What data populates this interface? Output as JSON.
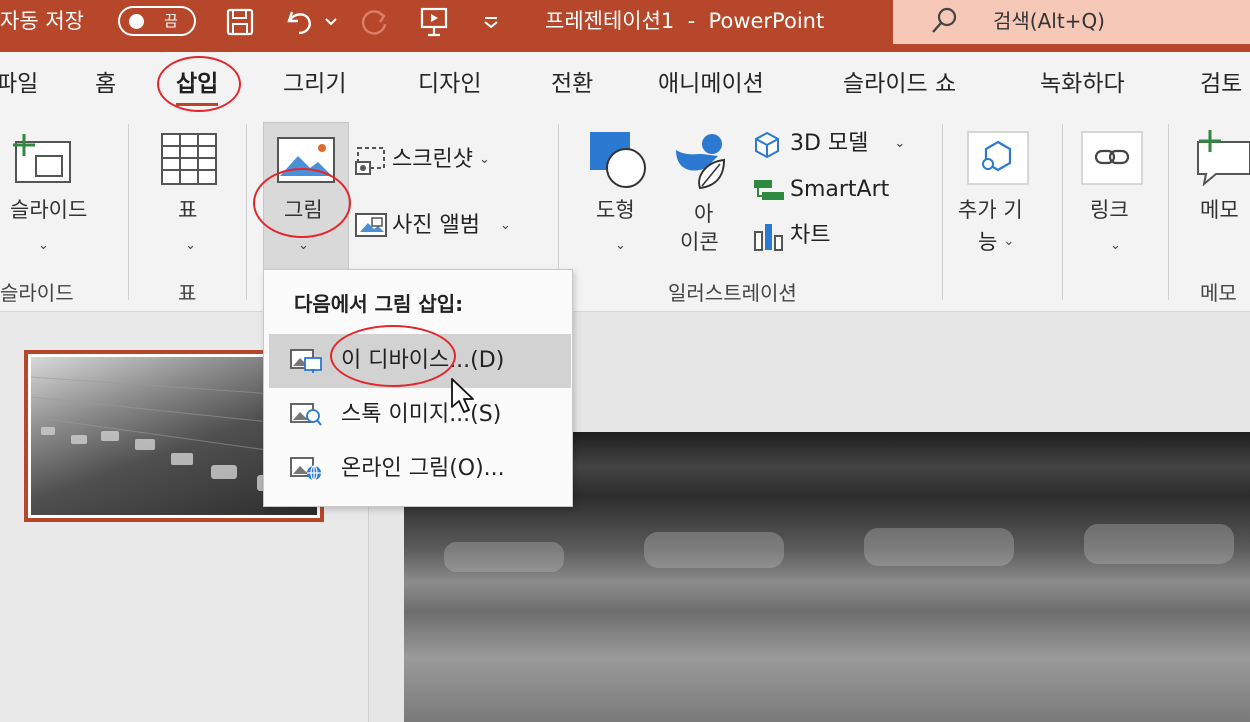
{
  "titlebar": {
    "autosave_label": "자동 저장",
    "autosave_state": "끔",
    "title": "프레젠테이션1  -  PowerPoint",
    "search_placeholder": "검색(Alt+Q)",
    "bg_color": "#b7472a"
  },
  "tabs": [
    "파일",
    "홈",
    "삽입",
    "그리기",
    "디자인",
    "전환",
    "애니메이션",
    "슬라이드 쇼",
    "녹화하다",
    "검토"
  ],
  "active_tab": "삽입",
  "ribbon": {
    "slide_button": "슬라이드",
    "slide_group": "슬라이드",
    "table_button": "표",
    "table_group": "표",
    "picture_button": "그림",
    "screenshot_button": "스크린샷",
    "photo_album_button": "사진 앨범",
    "shapes_button": "도형",
    "icons_button_line1": "아",
    "icons_button_line2": "이콘",
    "model3d_button": "3D 모델",
    "smartart_button": "SmartArt",
    "chart_button": "차트",
    "illustrations_group": "일러스트레이션",
    "addins_button_line1": "추가 기",
    "addins_button_line2": "능",
    "link_button": "링크",
    "comment_button": "메모",
    "comment_group": "메모"
  },
  "picture_menu": {
    "title": "다음에서 그림 삽입:",
    "items": [
      {
        "label": "이 디바이스...(D)",
        "icon": "device-picture-icon"
      },
      {
        "label": "스톡 이미지...(S)",
        "icon": "stock-image-icon"
      },
      {
        "label": "온라인 그림(O)...",
        "icon": "online-picture-icon"
      }
    ]
  },
  "colors": {
    "accent": "#b7472a",
    "annotation": "#e3262c",
    "icon_blue": "#2b79d0"
  }
}
